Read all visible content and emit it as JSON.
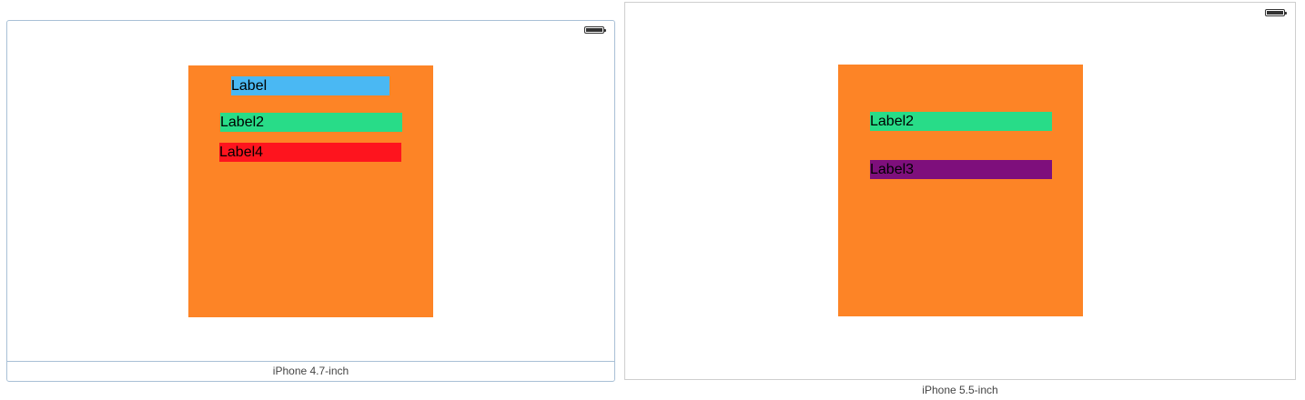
{
  "colors": {
    "orange": "#fd8426",
    "blue": "#4ab8f3",
    "green": "#28dc88",
    "red": "#fe141e",
    "purple": "#7e0f7c"
  },
  "device_47": {
    "caption": "iPhone 4.7-inch",
    "status_icon": "battery-icon",
    "labels": [
      {
        "text": "Label",
        "color": "blue"
      },
      {
        "text": "Label2",
        "color": "green"
      },
      {
        "text": "Label4",
        "color": "red"
      }
    ]
  },
  "device_55": {
    "caption": "iPhone 5.5-inch",
    "status_icon": "battery-icon",
    "labels": [
      {
        "text": "Label2",
        "color": "green"
      },
      {
        "text": "Label3",
        "color": "purple"
      }
    ]
  }
}
